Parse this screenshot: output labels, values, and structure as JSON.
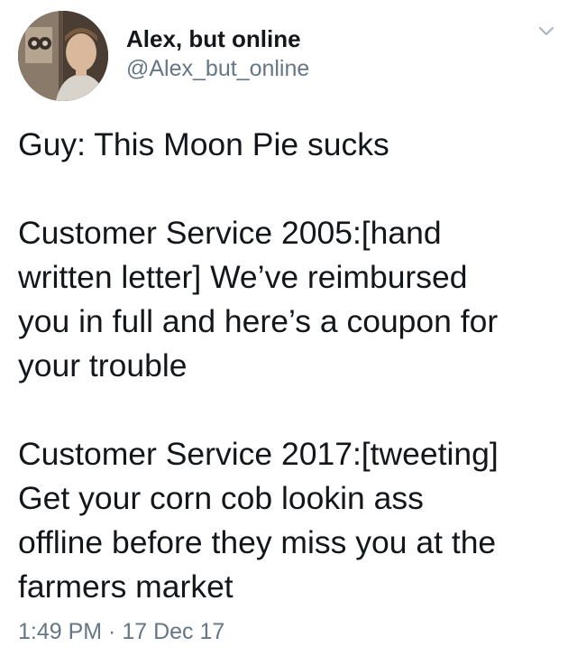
{
  "tweet": {
    "author": {
      "display_name": "Alex, but online",
      "handle": "@Alex_but_online",
      "avatar_icon": "profile-photo"
    },
    "menu_icon": "chevron-down-icon",
    "paragraphs": [
      "Guy: This Moon Pie sucks",
      "Customer Service 2005:[hand\nwritten letter] We’ve reimbursed\nyou in full and here’s a coupon for\nyour trouble",
      "Customer Service 2017:[tweeting]\nGet your corn cob lookin ass\noffline before they miss you at the\nfarmers market"
    ],
    "timestamp": "1:49 PM · 17 Dec 17"
  },
  "colors": {
    "text": "#14171a",
    "secondary_text": "#657786",
    "chevron": "#aab8c2",
    "background": "#ffffff"
  }
}
